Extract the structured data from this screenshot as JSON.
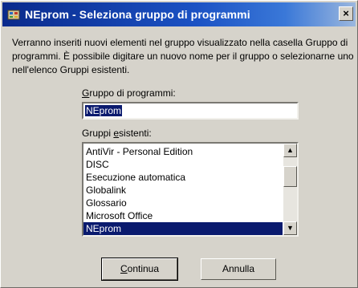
{
  "window": {
    "title": "NEprom - Seleziona gruppo di programmi",
    "close_symbol": "×"
  },
  "description": "Verranno inseriti nuovi elementi nel gruppo visualizzato nella casella Gruppo di programmi. È possibile digitare un nuovo nome per il gruppo o selezionarne uno nell'elenco Gruppi esistenti.",
  "program_group": {
    "label_accel": "G",
    "label_rest": "ruppo di programmi:",
    "value": "NEprom"
  },
  "existing_groups": {
    "label_pre": "Gruppi ",
    "label_accel": "e",
    "label_rest": "sistenti:",
    "items": [
      "AntiVir - Personal Edition",
      "DISC",
      "Esecuzione automatica",
      "Globalink",
      "Glossario",
      "Microsoft Office",
      "NEprom"
    ],
    "selected": "NEprom",
    "scroll_up_symbol": "▲",
    "scroll_down_symbol": "▼"
  },
  "buttons": {
    "continue_accel": "C",
    "continue_rest": "ontinua",
    "cancel": "Annulla"
  },
  "icons": {
    "title_icon": "program-group-icon"
  },
  "colors": {
    "titlebar_start": "#0a2a8c",
    "titlebar_end": "#9bb7de",
    "selection": "#0a1a6e",
    "dialog_face": "#d6d3cb"
  }
}
